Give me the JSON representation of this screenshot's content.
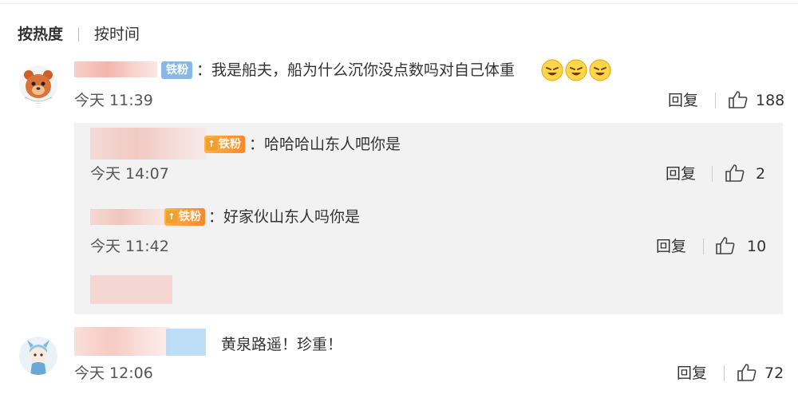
{
  "sort": {
    "hot_label": "按热度",
    "time_label": "按时间"
  },
  "colors": {
    "badge_blue": "#8ab8e6",
    "badge_orange": "#f7892c",
    "reply_bg": "#f2f2f2"
  },
  "comments": [
    {
      "badge": "铁粉",
      "text": "：我是船夫，船为什么沉你没点数吗对自己体重",
      "emoji_count": 3,
      "time": "今天 11:39",
      "reply_label": "回复",
      "likes": "188",
      "avatar_icon": "bear-avatar-icon"
    },
    {
      "badge": "铁粉",
      "text": "：哈哈哈山东人吧你是",
      "time": "今天 14:07",
      "reply_label": "回复",
      "likes": "2"
    },
    {
      "badge": "铁粉",
      "text": "：好家伙山东人吗你是",
      "time": "今天 11:42",
      "reply_label": "回复",
      "likes": "10"
    },
    {
      "text": "黄泉路遥！珍重！",
      "time": "今天 12:06",
      "reply_label": "回复",
      "likes": "72",
      "avatar_icon": "anime-avatar-icon"
    }
  ]
}
